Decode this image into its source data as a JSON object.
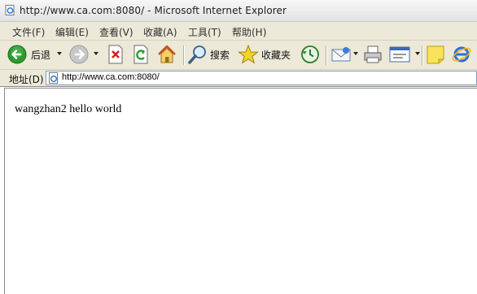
{
  "window": {
    "title": "http://www.ca.com:8080/ - Microsoft Internet Explorer"
  },
  "menu": {
    "items": [
      "文件(F)",
      "编辑(E)",
      "查看(V)",
      "收藏(A)",
      "工具(T)",
      "帮助(H)"
    ]
  },
  "toolbar": {
    "back_label": "后退",
    "search_label": "搜索",
    "favorites_label": "收藏夹",
    "icons": [
      "back-icon",
      "forward-icon",
      "stop-icon",
      "refresh-icon",
      "home-icon",
      "search-icon",
      "favorites-star-icon",
      "history-icon",
      "mail-icon",
      "print-icon",
      "edit-icon",
      "notes-icon",
      "ie-icon"
    ]
  },
  "address": {
    "label": "地址(D)",
    "url": "http://www.ca.com:8080/"
  },
  "page": {
    "body_text": "wangzhan2 hello world"
  },
  "colors": {
    "chrome_bg": "#ece9d8",
    "back_green": "#2e9a2e",
    "stop_red": "#d42020",
    "address_border": "#7f9db9"
  }
}
